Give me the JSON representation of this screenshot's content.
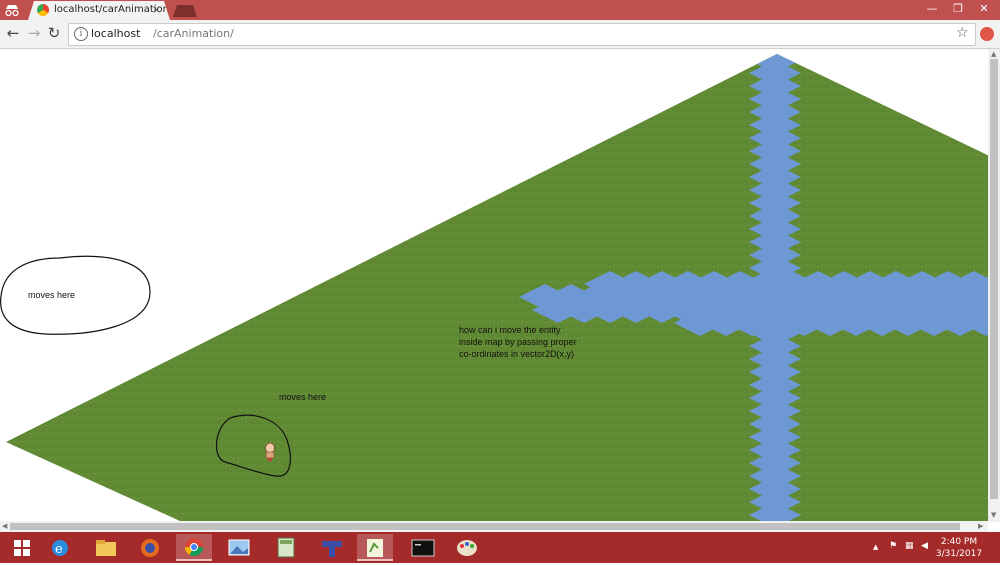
{
  "browser": {
    "tab_title": "localhost/carAnimation/",
    "tab_close": "×",
    "url_host": "localhost",
    "url_path": "/carAnimation/",
    "window_controls": {
      "minimize": "—",
      "restore": "❐",
      "close": "✕"
    },
    "nav": {
      "back": "←",
      "forward": "→",
      "reload": "↻"
    }
  },
  "page": {
    "annotation_left": "moves here",
    "annotation_map": "moves here",
    "question_lines": [
      "how can i move the entity",
      "inside map by passing proper",
      "co-ordinates in vector2D(x,y)"
    ]
  },
  "taskbar": {
    "apps": [
      "windows-start",
      "internet-explorer",
      "file-explorer",
      "firefox",
      "chrome",
      "photos",
      "calculator",
      "tetris",
      "notepad-plus",
      "command-prompt",
      "paint"
    ],
    "active_app": "chrome",
    "tray_caret": "▲",
    "clock_time": "2:40 PM",
    "clock_date": "3/31/2017"
  },
  "colors": {
    "title_bar": "#c0504d",
    "taskbar": "#a52b2b",
    "grass": "#5f8a34",
    "water": "#6e98d4"
  }
}
